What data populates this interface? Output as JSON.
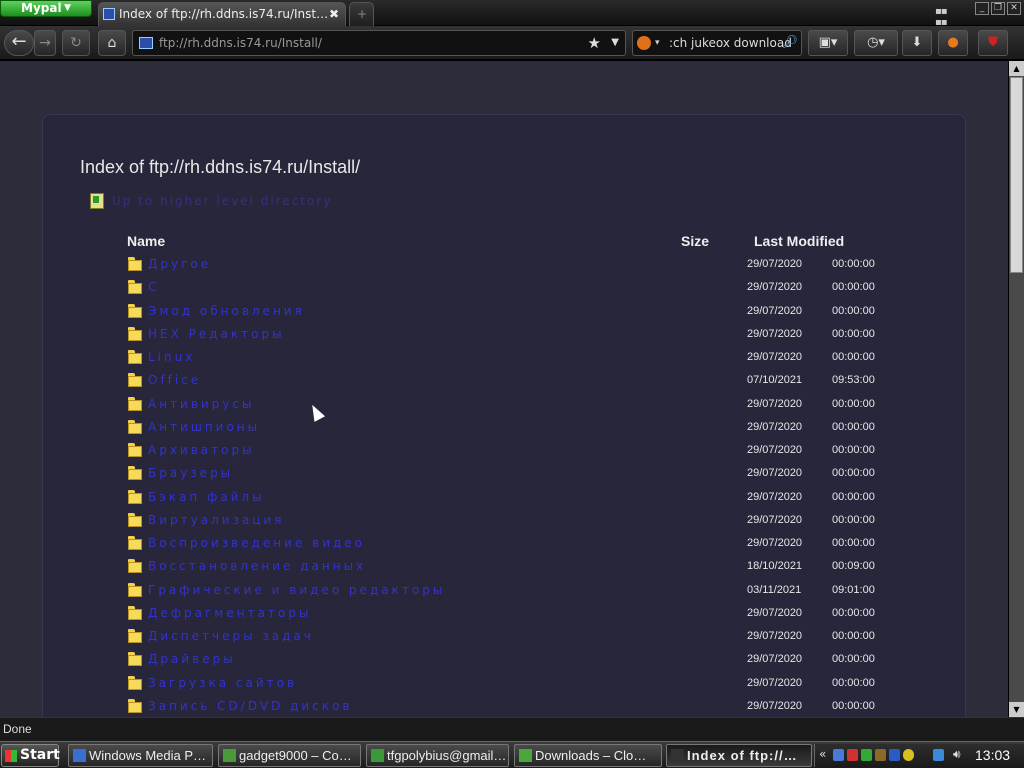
{
  "browser": {
    "app_button": "Mypal",
    "active_tab_title": "Index of ftp://rh.ddns.is74.ru/Inst…",
    "url": "ftp://rh.ddns.is74.ru/Install/",
    "search_text": ":ch jukeox download",
    "status": "Done"
  },
  "page": {
    "title": "Index of ftp://rh.ddns.is74.ru/Install/",
    "up_label": "Up to higher level directory",
    "headers": {
      "name": "Name",
      "size": "Size",
      "modified": "Last Modified"
    },
    "rows": [
      {
        "name": "Другое",
        "date": "29/07/2020",
        "time": "00:00:00"
      },
      {
        "name": "С",
        "date": "29/07/2020",
        "time": "00:00:00"
      },
      {
        "name": "Эмод обновления",
        "date": "29/07/2020",
        "time": "00:00:00"
      },
      {
        "name": "HEX Редакторы",
        "date": "29/07/2020",
        "time": "00:00:00"
      },
      {
        "name": "Linux",
        "date": "29/07/2020",
        "time": "00:00:00"
      },
      {
        "name": "Office",
        "date": "07/10/2021",
        "time": "09:53:00"
      },
      {
        "name": "Антивирусы",
        "date": "29/07/2020",
        "time": "00:00:00"
      },
      {
        "name": "Антишпионы",
        "date": "29/07/2020",
        "time": "00:00:00"
      },
      {
        "name": "Архиваторы",
        "date": "29/07/2020",
        "time": "00:00:00"
      },
      {
        "name": "Браузеры",
        "date": "29/07/2020",
        "time": "00:00:00"
      },
      {
        "name": "Бэкап файлы",
        "date": "29/07/2020",
        "time": "00:00:00"
      },
      {
        "name": "Виртуализация",
        "date": "29/07/2020",
        "time": "00:00:00"
      },
      {
        "name": "Воспроизведение видео",
        "date": "29/07/2020",
        "time": "00:00:00"
      },
      {
        "name": "Восстановление данных",
        "date": "18/10/2021",
        "time": "00:09:00"
      },
      {
        "name": "Графические и видео редакторы",
        "date": "03/11/2021",
        "time": "09:01:00"
      },
      {
        "name": "Дефрагментаторы",
        "date": "29/07/2020",
        "time": "00:00:00"
      },
      {
        "name": "Диспетчеры задач",
        "date": "29/07/2020",
        "time": "00:00:00"
      },
      {
        "name": "Драйверы",
        "date": "29/07/2020",
        "time": "00:00:00"
      },
      {
        "name": "Загрузка сайтов",
        "date": "29/07/2020",
        "time": "00:00:00"
      },
      {
        "name": "Запись CD/DVD дисков",
        "date": "29/07/2020",
        "time": "00:00:00"
      }
    ]
  },
  "taskbar": {
    "start": "Start",
    "tasks": [
      {
        "label": "Windows Media P…"
      },
      {
        "label": "gadget9000 – Co…"
      },
      {
        "label": "tfgpolybius@gmail…"
      },
      {
        "label": "Downloads – Clo…"
      },
      {
        "label": "Index of ftp://…"
      }
    ],
    "clock": "13:03"
  },
  "colors": {
    "link": "#3333cc",
    "page_bg": "#2d2c3a",
    "panel_bg": "#27263a",
    "folder": "#f6db5a"
  },
  "icons": [
    "back-arrow-icon",
    "forward-arrow-icon",
    "reload-icon",
    "home-icon",
    "bookmark-star-icon",
    "search-magnifier-icon",
    "download-arrow-icon",
    "history-clock-icon",
    "folder-icon",
    "up-folder-icon"
  ]
}
